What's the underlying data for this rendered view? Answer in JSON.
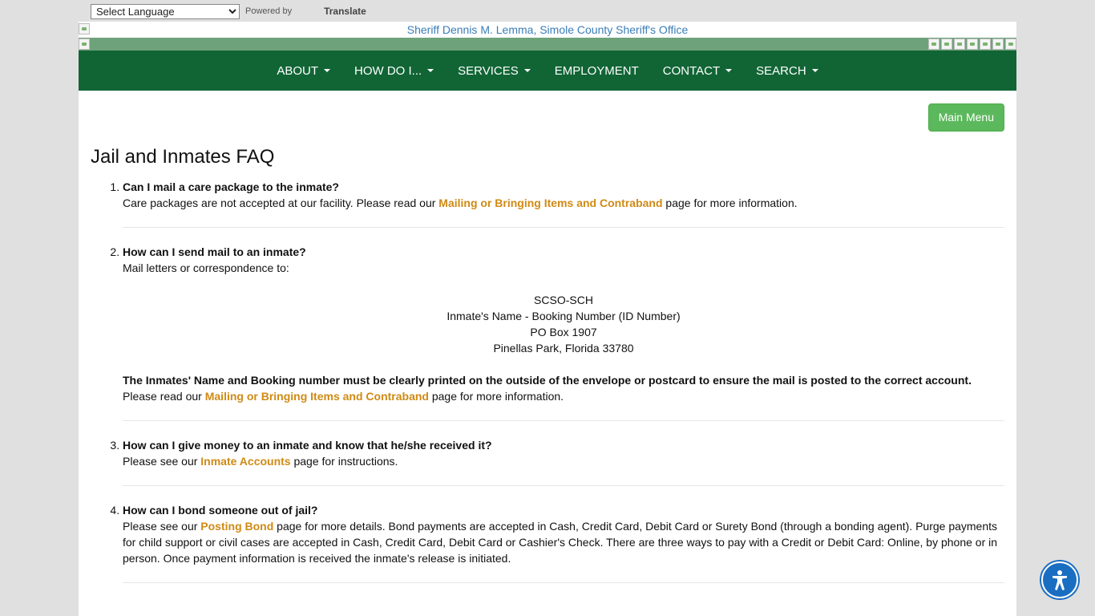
{
  "translate": {
    "select_label": "Select Language",
    "powered_by": "Powered by",
    "translate_link": "Translate"
  },
  "header": {
    "title": "Sheriff Dennis M. Lemma, Simole County Sheriff's Office"
  },
  "nav": {
    "items": [
      {
        "label": "ABOUT",
        "dropdown": true
      },
      {
        "label": "HOW DO I...",
        "dropdown": true
      },
      {
        "label": "SERVICES",
        "dropdown": true
      },
      {
        "label": "EMPLOYMENT",
        "dropdown": false
      },
      {
        "label": "CONTACT",
        "dropdown": true
      },
      {
        "label": "SEARCH",
        "dropdown": true
      }
    ]
  },
  "main_menu_label": "Main Menu",
  "page_title": "Jail and Inmates FAQ",
  "faq": {
    "q1": {
      "question": "Can I mail a care package to the inmate?",
      "answer_pre": "Care packages are not accepted at our facility. Please read our ",
      "link": "Mailing or Bringing Items and Contraband",
      "answer_post": " page for more information."
    },
    "q2": {
      "question": "How can I send mail to an inmate?",
      "intro": "Mail letters or correspondence to:",
      "address": [
        "SCSO-SCH",
        "Inmate's Name - Booking Number (ID Number)",
        "PO Box 1907",
        "Pinellas Park, Florida 33780"
      ],
      "notice": "The Inmates' Name and Booking number must be clearly printed on the outside of the envelope or postcard to ensure the mail is posted to the correct account.",
      "answer_pre": "Please read our ",
      "link": "Mailing or Bringing Items and Contraband",
      "answer_post": " page for more information."
    },
    "q3": {
      "question": "How can I give money to an inmate and know that he/she received it?",
      "answer_pre": "Please see our ",
      "link": "Inmate Accounts",
      "answer_post": " page for instructions."
    },
    "q4": {
      "question": "How can I bond someone out of jail?",
      "answer_pre": "Please see our ",
      "link": "Posting Bond",
      "answer_post": " page for more details. Bond payments are accepted in Cash, Credit Card, Debit Card or Surety Bond (through a bonding agent). Purge payments for child support or civil cases are accepted in Cash, Credit Card, Debit Card or Cashier's Check. There are three ways to pay with a Credit or Debit Card: Online, by phone or in person. Once payment information is received the inmate's release is initiated."
    }
  },
  "colors": {
    "nav_green": "#116535",
    "strip_green": "#6ea27a",
    "link_orange": "#d08a15",
    "button_green": "#5cb85c",
    "accessibility_blue": "#1a6ec2"
  }
}
